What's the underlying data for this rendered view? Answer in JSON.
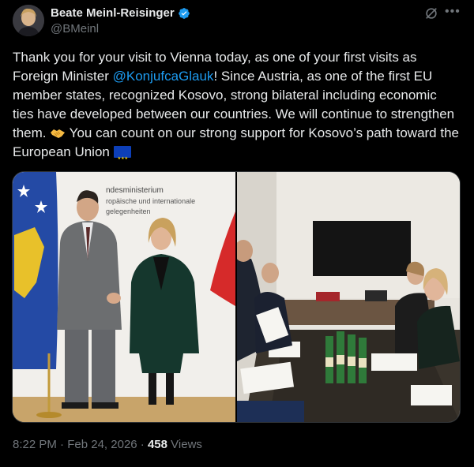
{
  "author": {
    "display_name": "Beate Meinl-Reisinger",
    "handle": "@BMeinl"
  },
  "tweet": {
    "text_1": "Thank you for your visit to Vienna today, as one of your first visits as Foreign Minister ",
    "mention": "@KonjufcaGlauk",
    "text_2": "! Since Austria, as one of the first EU member states, recognized Kosovo, strong bilateral including economic ties have developed between our countries. We will continue to strengthen them. ",
    "text_3": " You can count on our strong support for Kosovo’s path toward the European Union ",
    "emoji_icons": [
      "handshake-icon",
      "eu-flag-icon"
    ]
  },
  "media": {
    "photo_1_sign_lines": [
      "ndesministerium",
      "ropäische und internationale",
      "gelegenheiten"
    ]
  },
  "meta": {
    "time": "8:22 PM",
    "separator": "·",
    "date": "Feb 24, 2026",
    "views_count": "458",
    "views_label": "Views"
  },
  "icons": {
    "verified": "verified-badge-icon",
    "grok": "grok-icon",
    "more": "more-icon"
  },
  "colors": {
    "background": "#000000",
    "text": "#e7e9ea",
    "secondary": "#71767b",
    "link": "#1d9bf0"
  }
}
